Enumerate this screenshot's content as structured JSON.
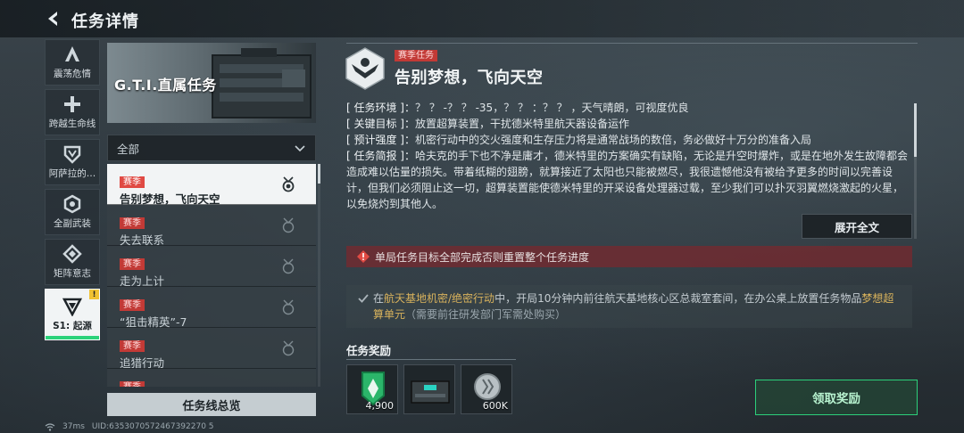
{
  "header": {
    "title": "任务详情"
  },
  "rail": {
    "items": [
      {
        "label": "震荡危情",
        "icon": "a-shape-icon"
      },
      {
        "label": "跨越生命线",
        "icon": "plus-icon"
      },
      {
        "label": "阿萨拉的…",
        "icon": "shield-v-icon"
      },
      {
        "label": "全副武装",
        "icon": "hex-icon"
      },
      {
        "label": "矩阵意志",
        "icon": "diamond-icon"
      },
      {
        "label": "S1: 起源",
        "icon": "triangle-icon",
        "badge": "!"
      }
    ]
  },
  "banner": {
    "title": "G.T.I.直属任务"
  },
  "filter": {
    "label": "全部"
  },
  "tasks": [
    {
      "tag": "赛季",
      "name": "告别梦想，飞向天空"
    },
    {
      "tag": "赛季",
      "name": "失去联系"
    },
    {
      "tag": "赛季",
      "name": "走为上计"
    },
    {
      "tag": "赛季",
      "name": "“狙击精英”-7"
    },
    {
      "tag": "赛季",
      "name": "追猎行动"
    },
    {
      "tag": "赛季",
      "name": ""
    }
  ],
  "overview_button": "任务线总览",
  "status": {
    "ping": "37ms",
    "uid": "UID:6353070572467392270 5"
  },
  "detail": {
    "tag": "赛季任务",
    "title": "告别梦想，飞向天空",
    "lines": [
      {
        "key": "[ 任务环境 ]：",
        "text": "？ ？ -？ ？ -35，？ ？ ：？ ？ ，天气晴朗，可视度优良"
      },
      {
        "key": "[ 关键目标 ]：",
        "text": "放置超算装置，干扰德米特里航天器设备运作"
      },
      {
        "key": "[ 预计强度 ]：",
        "text": "机密行动中的交火强度和生存压力将是通常战场的数倍，务必做好十万分的准备入局"
      },
      {
        "key": "[ 任务简报 ]：",
        "text": "哈夫克的手下也不净是庸才，德米特里的方案确实有缺陷，无论是升空时爆炸，或是在地外发生故障都会造成难以估量的损失。带着纸糊的翅膀，就算接近了太阳也只能被燃尽，我很遗憾他没有被给予更多的时间以完善设计，但我们必须阻止这一切，超算装置能使德米特里的开采设备处理器过载，至少我们可以扑灭羽翼燃烧激起的火星，以免烧灼到其他人。"
      }
    ],
    "expand_label": "展开全文",
    "warning": "单局任务目标全部完成否则重置整个任务进度",
    "objective": {
      "prefix": "在",
      "location": "航天基地机密/绝密行动",
      "middle": "中，开局10分钟内前往航天基地核心区总裁室套间，在办公桌上放置任务物品",
      "item": "梦想超算单元",
      "note": "（需要前往研发部门军需处购买）"
    },
    "rewards_title": "任务奖励",
    "rewards": [
      {
        "qty": "4,900",
        "icon": "green-badge-icon",
        "color": "#2bb56a"
      },
      {
        "qty": "",
        "icon": "device-case-icon",
        "color": "#2ad2c2"
      },
      {
        "qty": "600K",
        "icon": "silver-coin-icon",
        "color": "#b8c0c4"
      }
    ],
    "claim_label": "领取奖励"
  }
}
